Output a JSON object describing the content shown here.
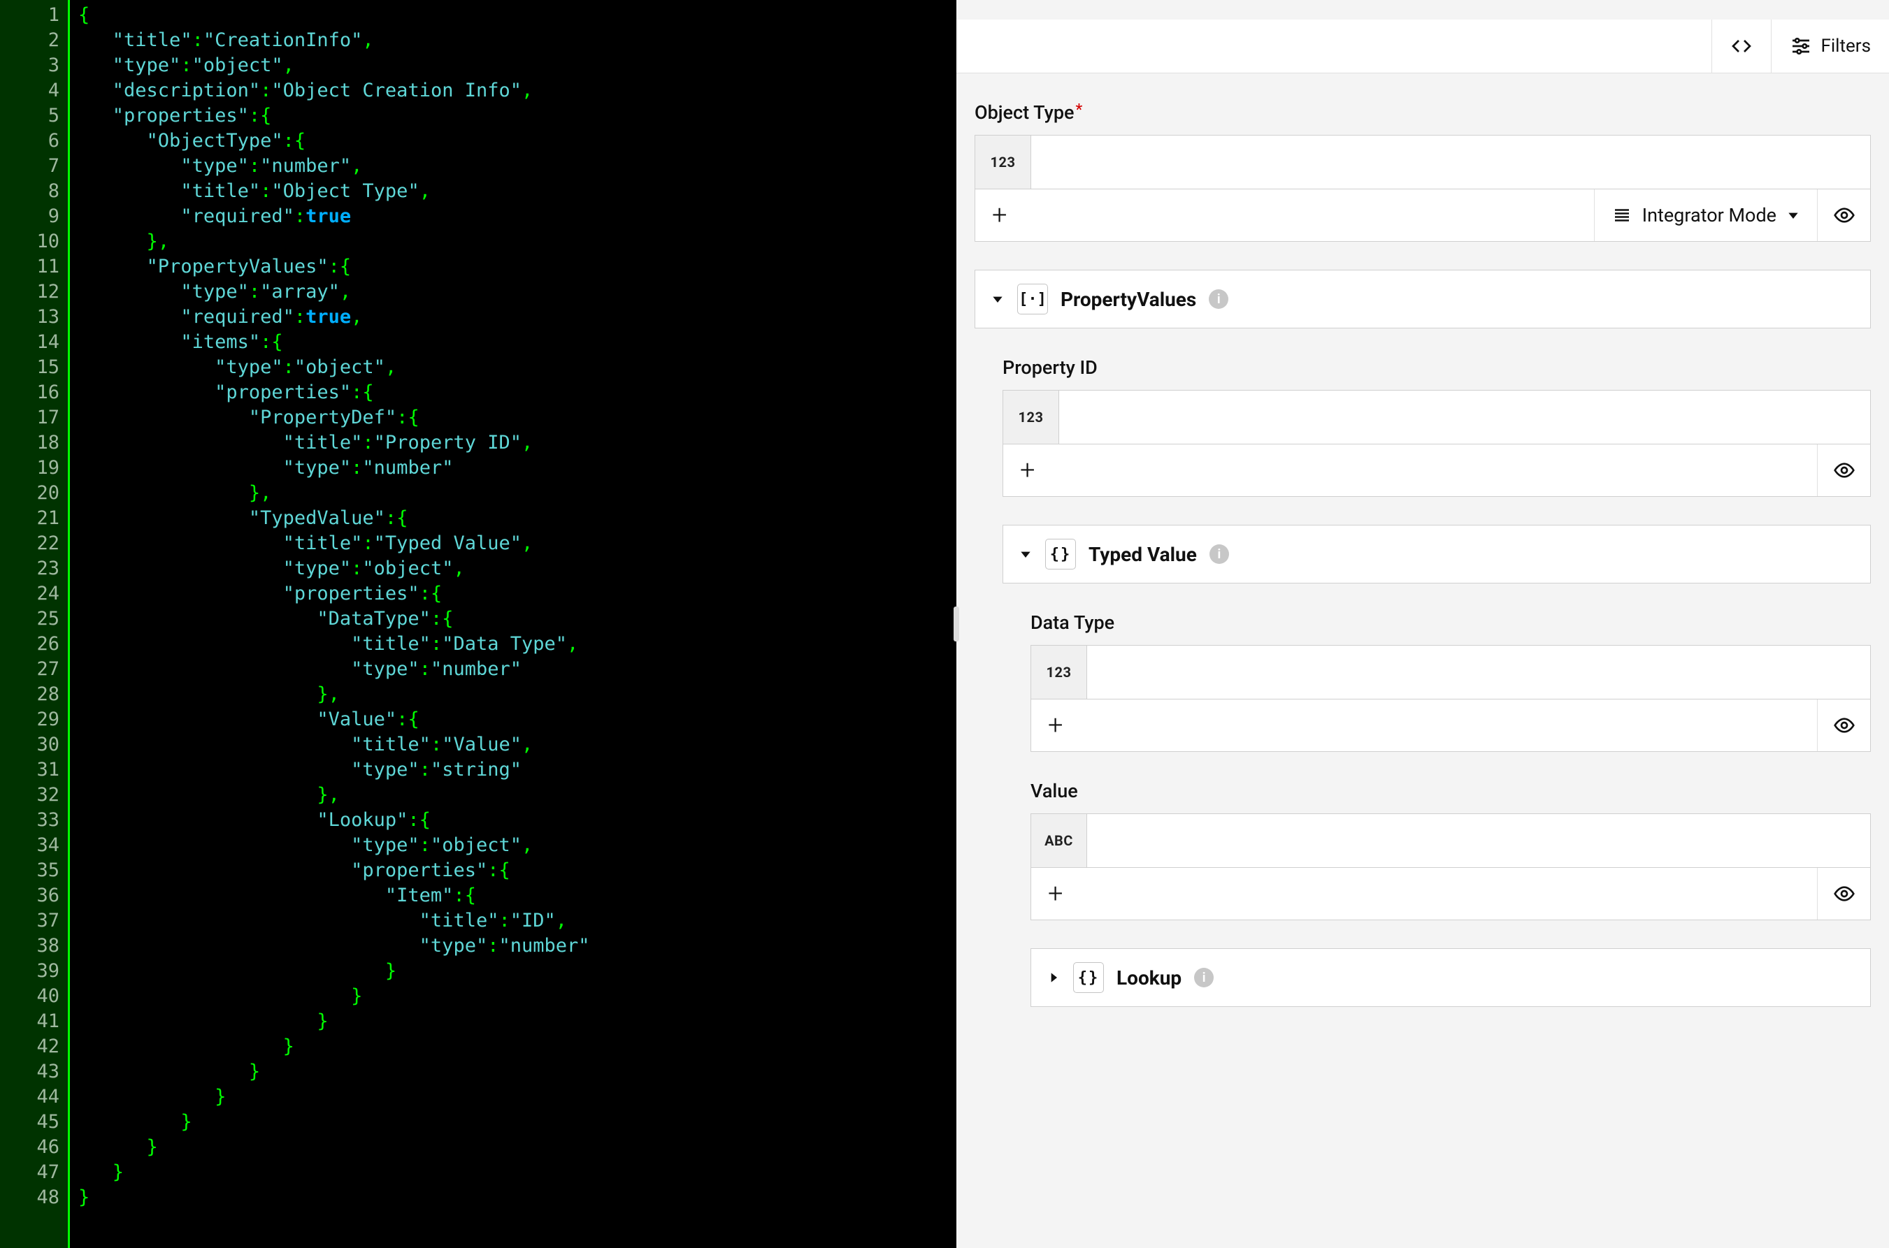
{
  "toolbar": {
    "filters_label": "Filters",
    "integrator_mode_label": "Integrator Mode"
  },
  "editor": {
    "line_count": 48,
    "json_source": {
      "title": "CreationInfo",
      "type": "object",
      "description": "Object Creation Info",
      "properties": {
        "ObjectType": {
          "type": "number",
          "title": "Object Type",
          "required": true
        },
        "PropertyValues": {
          "type": "array",
          "required": true,
          "items": {
            "type": "object",
            "properties": {
              "PropertyDef": {
                "title": "Property ID",
                "type": "number"
              },
              "TypedValue": {
                "title": "Typed Value",
                "type": "object",
                "properties": {
                  "DataType": {
                    "title": "Data Type",
                    "type": "number"
                  },
                  "Value": {
                    "title": "Value",
                    "type": "string"
                  },
                  "Lookup": {
                    "type": "object",
                    "properties": {
                      "Item": {
                        "title": "ID",
                        "type": "number"
                      }
                    }
                  }
                }
              }
            }
          }
        }
      }
    }
  },
  "form": {
    "object_type": {
      "label": "Object Type",
      "required": true,
      "badge": "123"
    },
    "property_values": {
      "title": "PropertyValues",
      "type_icon": "[·]"
    },
    "property_id": {
      "label": "Property ID",
      "badge": "123"
    },
    "typed_value": {
      "title": "Typed Value",
      "type_icon": "{}"
    },
    "data_type": {
      "label": "Data Type",
      "badge": "123"
    },
    "value": {
      "label": "Value",
      "badge": "ABC"
    },
    "lookup": {
      "title": "Lookup",
      "type_icon": "{}"
    }
  }
}
